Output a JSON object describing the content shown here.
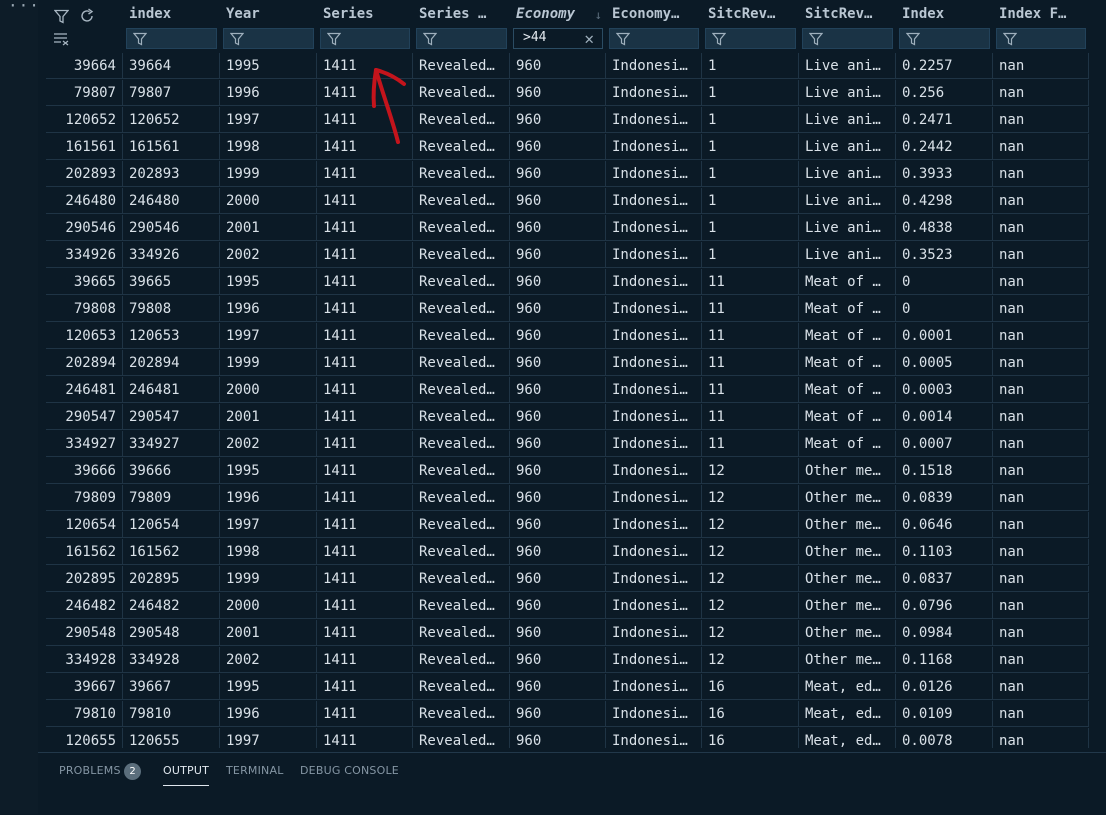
{
  "toolbar": {
    "more": "···",
    "filter_icon": "filter-icon",
    "refresh_icon": "refresh-icon",
    "clear_icon": "clear-filters-icon"
  },
  "columns": [
    {
      "label": "index",
      "filter": "",
      "italic": false
    },
    {
      "label": "Year",
      "filter": "",
      "italic": false
    },
    {
      "label": "Series",
      "filter": "",
      "italic": false
    },
    {
      "label": "Series …",
      "filter": "",
      "italic": false
    },
    {
      "label": "Economy",
      "filter": ">44",
      "italic": true,
      "sort": "↓"
    },
    {
      "label": "Economy…",
      "filter": "",
      "italic": false
    },
    {
      "label": "SitcRev…",
      "filter": "",
      "italic": false
    },
    {
      "label": "SitcRev…",
      "filter": "",
      "italic": false
    },
    {
      "label": "Index",
      "filter": "",
      "italic": false
    },
    {
      "label": "Index F…",
      "filter": "",
      "italic": false
    }
  ],
  "rows": [
    [
      "39664",
      "39664",
      "1995",
      "1411",
      "Revealed…",
      "960",
      "Indonesi…",
      "1",
      "Live ani…",
      "0.2257",
      "nan"
    ],
    [
      "79807",
      "79807",
      "1996",
      "1411",
      "Revealed…",
      "960",
      "Indonesi…",
      "1",
      "Live ani…",
      "0.256",
      "nan"
    ],
    [
      "120652",
      "120652",
      "1997",
      "1411",
      "Revealed…",
      "960",
      "Indonesi…",
      "1",
      "Live ani…",
      "0.2471",
      "nan"
    ],
    [
      "161561",
      "161561",
      "1998",
      "1411",
      "Revealed…",
      "960",
      "Indonesi…",
      "1",
      "Live ani…",
      "0.2442",
      "nan"
    ],
    [
      "202893",
      "202893",
      "1999",
      "1411",
      "Revealed…",
      "960",
      "Indonesi…",
      "1",
      "Live ani…",
      "0.3933",
      "nan"
    ],
    [
      "246480",
      "246480",
      "2000",
      "1411",
      "Revealed…",
      "960",
      "Indonesi…",
      "1",
      "Live ani…",
      "0.4298",
      "nan"
    ],
    [
      "290546",
      "290546",
      "2001",
      "1411",
      "Revealed…",
      "960",
      "Indonesi…",
      "1",
      "Live ani…",
      "0.4838",
      "nan"
    ],
    [
      "334926",
      "334926",
      "2002",
      "1411",
      "Revealed…",
      "960",
      "Indonesi…",
      "1",
      "Live ani…",
      "0.3523",
      "nan"
    ],
    [
      "39665",
      "39665",
      "1995",
      "1411",
      "Revealed…",
      "960",
      "Indonesi…",
      "11",
      "Meat of …",
      "0",
      "nan"
    ],
    [
      "79808",
      "79808",
      "1996",
      "1411",
      "Revealed…",
      "960",
      "Indonesi…",
      "11",
      "Meat of …",
      "0",
      "nan"
    ],
    [
      "120653",
      "120653",
      "1997",
      "1411",
      "Revealed…",
      "960",
      "Indonesi…",
      "11",
      "Meat of …",
      "0.0001",
      "nan"
    ],
    [
      "202894",
      "202894",
      "1999",
      "1411",
      "Revealed…",
      "960",
      "Indonesi…",
      "11",
      "Meat of …",
      "0.0005",
      "nan"
    ],
    [
      "246481",
      "246481",
      "2000",
      "1411",
      "Revealed…",
      "960",
      "Indonesi…",
      "11",
      "Meat of …",
      "0.0003",
      "nan"
    ],
    [
      "290547",
      "290547",
      "2001",
      "1411",
      "Revealed…",
      "960",
      "Indonesi…",
      "11",
      "Meat of …",
      "0.0014",
      "nan"
    ],
    [
      "334927",
      "334927",
      "2002",
      "1411",
      "Revealed…",
      "960",
      "Indonesi…",
      "11",
      "Meat of …",
      "0.0007",
      "nan"
    ],
    [
      "39666",
      "39666",
      "1995",
      "1411",
      "Revealed…",
      "960",
      "Indonesi…",
      "12",
      "Other me…",
      "0.1518",
      "nan"
    ],
    [
      "79809",
      "79809",
      "1996",
      "1411",
      "Revealed…",
      "960",
      "Indonesi…",
      "12",
      "Other me…",
      "0.0839",
      "nan"
    ],
    [
      "120654",
      "120654",
      "1997",
      "1411",
      "Revealed…",
      "960",
      "Indonesi…",
      "12",
      "Other me…",
      "0.0646",
      "nan"
    ],
    [
      "161562",
      "161562",
      "1998",
      "1411",
      "Revealed…",
      "960",
      "Indonesi…",
      "12",
      "Other me…",
      "0.1103",
      "nan"
    ],
    [
      "202895",
      "202895",
      "1999",
      "1411",
      "Revealed…",
      "960",
      "Indonesi…",
      "12",
      "Other me…",
      "0.0837",
      "nan"
    ],
    [
      "246482",
      "246482",
      "2000",
      "1411",
      "Revealed…",
      "960",
      "Indonesi…",
      "12",
      "Other me…",
      "0.0796",
      "nan"
    ],
    [
      "290548",
      "290548",
      "2001",
      "1411",
      "Revealed…",
      "960",
      "Indonesi…",
      "12",
      "Other me…",
      "0.0984",
      "nan"
    ],
    [
      "334928",
      "334928",
      "2002",
      "1411",
      "Revealed…",
      "960",
      "Indonesi…",
      "12",
      "Other me…",
      "0.1168",
      "nan"
    ],
    [
      "39667",
      "39667",
      "1995",
      "1411",
      "Revealed…",
      "960",
      "Indonesi…",
      "16",
      "Meat, ed…",
      "0.0126",
      "nan"
    ],
    [
      "79810",
      "79810",
      "1996",
      "1411",
      "Revealed…",
      "960",
      "Indonesi…",
      "16",
      "Meat, ed…",
      "0.0109",
      "nan"
    ],
    [
      "120655",
      "120655",
      "1997",
      "1411",
      "Revealed…",
      "960",
      "Indonesi…",
      "16",
      "Meat, ed…",
      "0.0078",
      "nan"
    ]
  ],
  "panel": {
    "problems": "PROBLEMS",
    "problems_count": "2",
    "output": "OUTPUT",
    "terminal": "TERMINAL",
    "debug_console": "DEBUG CONSOLE"
  },
  "colors": {
    "background": "#0b1a26",
    "annotation_arrow": "#c4141c"
  }
}
